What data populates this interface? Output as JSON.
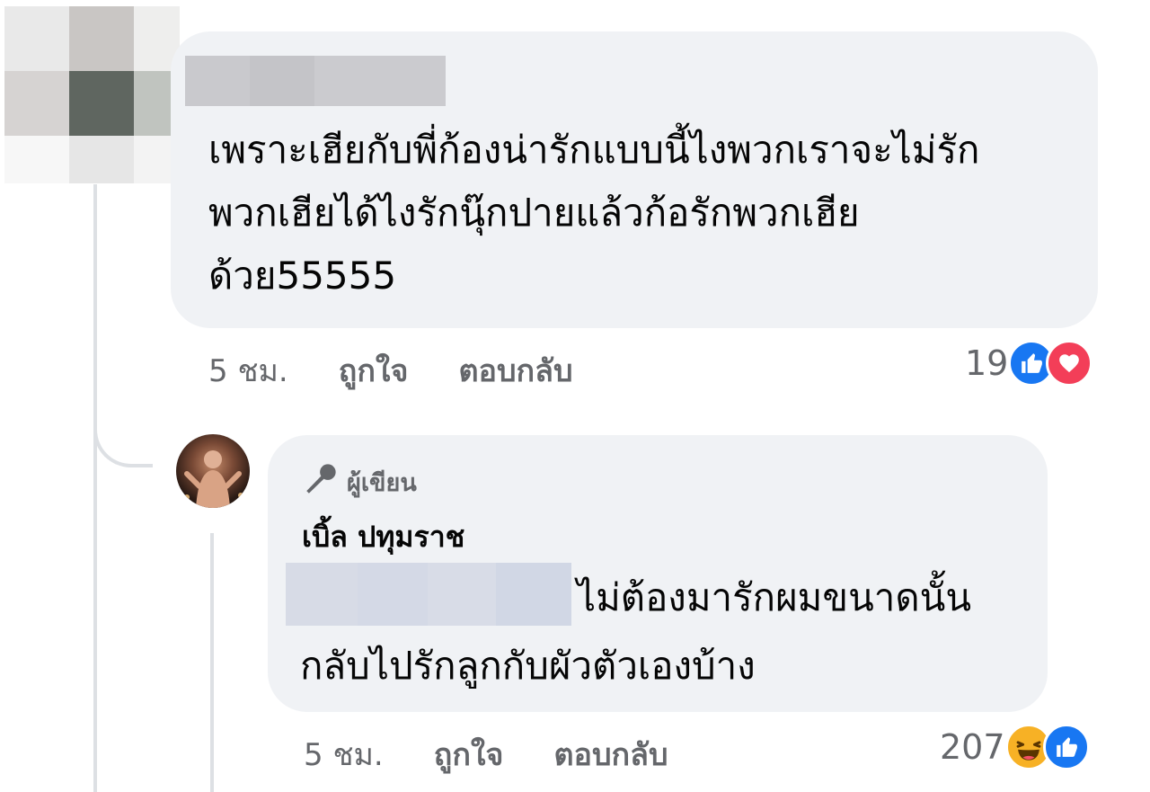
{
  "comment_1": {
    "text": "เพราะเฮียกับพี่ก้องน่ารักแบบนี้ไงพวกเราจะไม่รัก\nพวกเฮียได้ไงรักนุ๊กปายแล้วก้อรักพวกเฮีย\nด้วย55555",
    "time": "5 ชม.",
    "like_label": "ถูกใจ",
    "reply_label": "ตอบกลับ",
    "reaction_count": "19",
    "reactions": [
      "like-icon",
      "love-icon"
    ]
  },
  "comment_2": {
    "badge": "ผู้เขียน",
    "author": "เบิ้ล ปทุมราช",
    "text_line_1": "ไม่ต้องมารักผมขนาดนั้น",
    "text_line_2": "กลับไปรักลูกกับผัวตัวเองบ้าง",
    "time": "5 ชม.",
    "like_label": "ถูกใจ",
    "reply_label": "ตอบกลับ",
    "reaction_count": "207",
    "reactions": [
      "haha-icon",
      "like-icon"
    ]
  },
  "colors": {
    "bubble": "#f0f2f5",
    "meta_text": "#65676b",
    "like_blue": "#1877f2",
    "love_red": "#f33e58",
    "haha_yellow": "#f7b125"
  }
}
